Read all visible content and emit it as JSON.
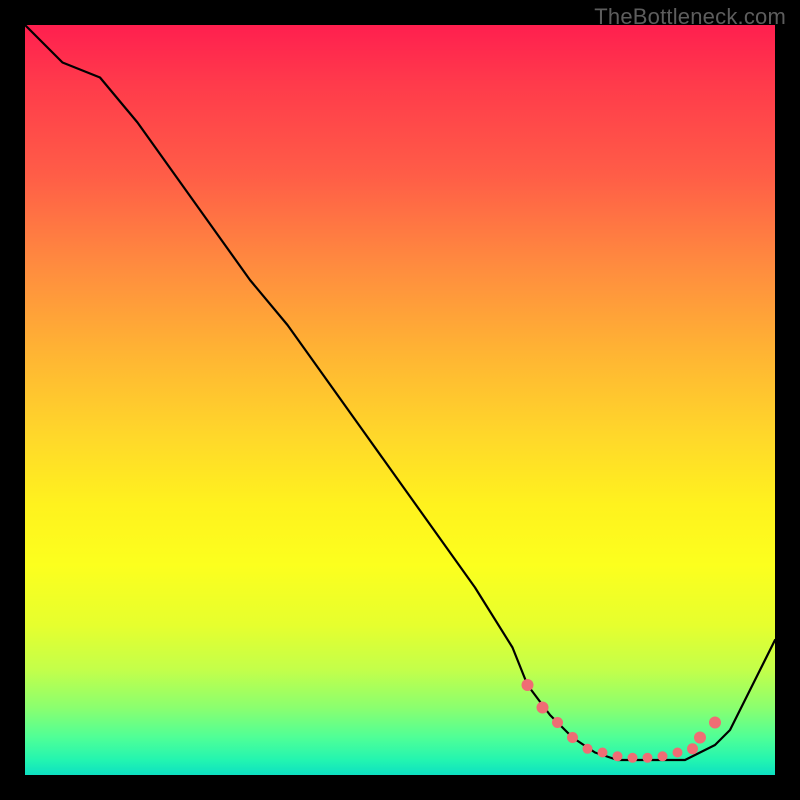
{
  "watermark": "TheBottleneck.com",
  "colors": {
    "background": "#000000",
    "curve_stroke": "#000000",
    "marker_fill": "#ef6d74",
    "gradient_top": "#ff1f4f",
    "gradient_bottom": "#0de0c2"
  },
  "chart_data": {
    "type": "line",
    "title": "",
    "xlabel": "",
    "ylabel": "",
    "xlim": [
      0,
      100
    ],
    "ylim": [
      0,
      100
    ],
    "x": [
      0,
      5,
      10,
      15,
      20,
      25,
      30,
      35,
      40,
      45,
      50,
      55,
      60,
      65,
      67,
      70,
      73,
      76,
      79,
      82,
      85,
      88,
      90,
      92,
      94,
      96,
      98,
      100
    ],
    "y": [
      100,
      95,
      93,
      87,
      80,
      73,
      66,
      60,
      53,
      46,
      39,
      32,
      25,
      17,
      12,
      8,
      5,
      3,
      2,
      2,
      2,
      2,
      3,
      4,
      6,
      10,
      14,
      18
    ],
    "markers": {
      "x": [
        67,
        69,
        71,
        73,
        75,
        77,
        79,
        81,
        83,
        85,
        87,
        89,
        90,
        92
      ],
      "y": [
        12,
        9,
        7,
        5,
        3.5,
        3,
        2.5,
        2.3,
        2.3,
        2.5,
        3,
        3.5,
        5,
        7
      ],
      "r": [
        6,
        6,
        5.5,
        5.5,
        5,
        5,
        5,
        5,
        5,
        5,
        5,
        5.5,
        6,
        6
      ]
    }
  }
}
